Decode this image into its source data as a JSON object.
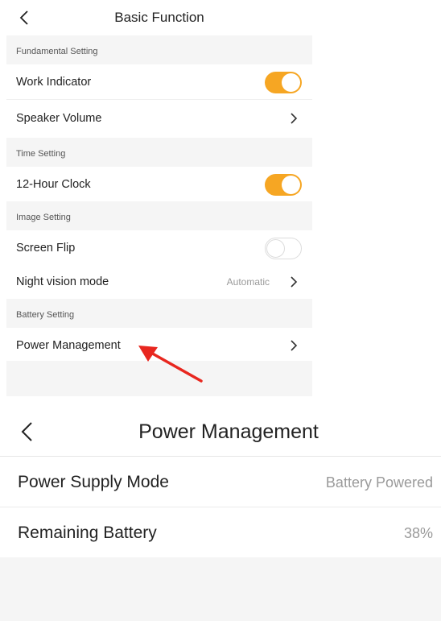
{
  "basic_function": {
    "title": "Basic Function",
    "sections": [
      {
        "label": "Fundamental Setting"
      },
      {
        "label": "Time Setting"
      },
      {
        "label": "Image Setting"
      },
      {
        "label": "Battery Setting"
      }
    ],
    "rows": {
      "work_indicator": {
        "label": "Work Indicator",
        "toggle": "on"
      },
      "speaker_volume": {
        "label": "Speaker Volume"
      },
      "hour_clock": {
        "label": "12-Hour Clock",
        "toggle": "on"
      },
      "screen_flip": {
        "label": "Screen Flip",
        "toggle": "off"
      },
      "night_vision": {
        "label": "Night vision mode",
        "value": "Automatic"
      },
      "power_management": {
        "label": "Power Management"
      }
    }
  },
  "power_management": {
    "title": "Power Management",
    "rows": [
      {
        "label": "Power Supply Mode",
        "value": "Battery Powered"
      },
      {
        "label": "Remaining Battery",
        "value": "38%"
      }
    ]
  },
  "colors": {
    "accent": "#f6a623",
    "annotation_arrow": "#e8271f",
    "section_bg": "#f5f5f5"
  },
  "icons": [
    "back-chevron-icon",
    "chevron-right-icon",
    "toggle-switch",
    "red-annotation-arrow"
  ]
}
